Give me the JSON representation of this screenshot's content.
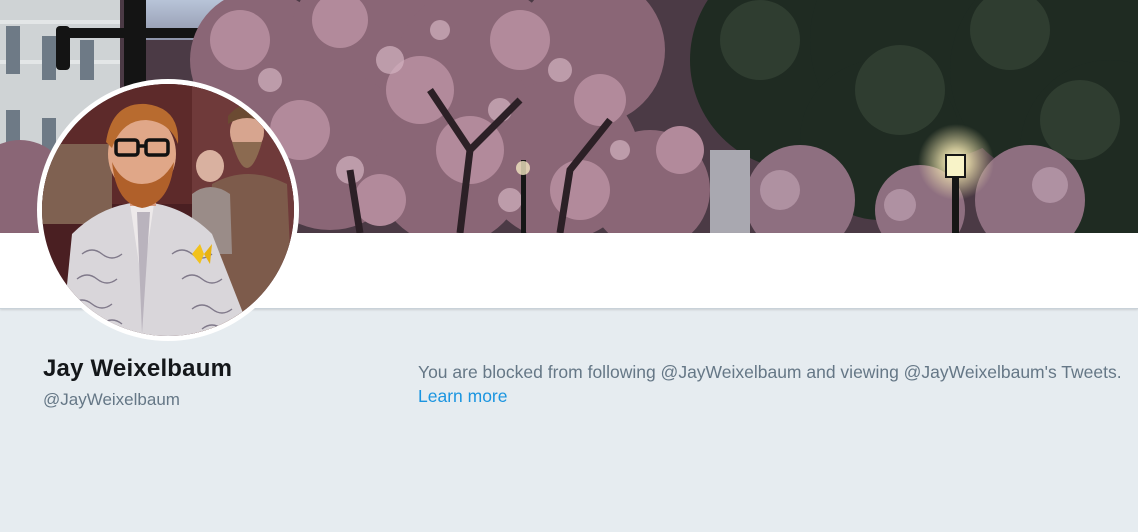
{
  "profile": {
    "name": "Jay Weixelbaum",
    "handle": "@JayWeixelbaum"
  },
  "blocked_notice": {
    "message": "You are blocked from following @JayWeixelbaum and viewing @JayWeixelbaum's Tweets.",
    "link_label": "Learn more"
  },
  "colors": {
    "background": "#e6ecf0",
    "name": "#14171a",
    "secondary_text": "#657786",
    "link": "#1b95e0"
  }
}
